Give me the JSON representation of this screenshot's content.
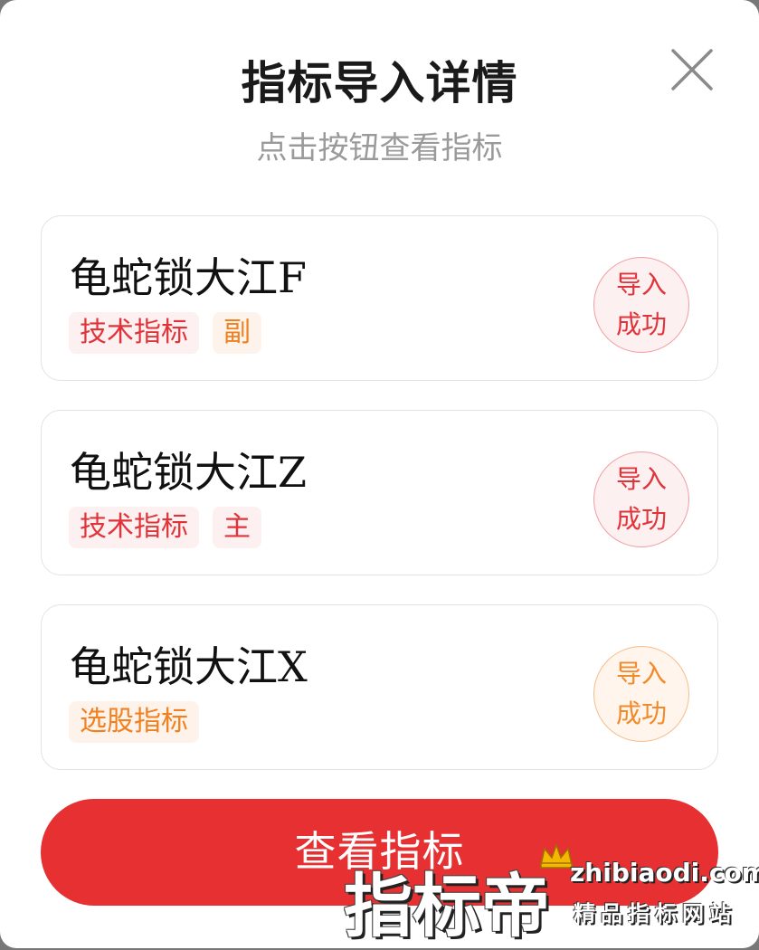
{
  "dialog": {
    "title": "指标导入详情",
    "subtitle": "点击按钮查看指标",
    "close_icon": "close-icon"
  },
  "items": [
    {
      "name": "龟蛇锁大江F",
      "tags": [
        {
          "label": "技术指标",
          "color": "red"
        },
        {
          "label": "副",
          "color": "orange"
        }
      ],
      "status_line1": "导入",
      "status_line2": "成功",
      "status_color": "red"
    },
    {
      "name": "龟蛇锁大江Z",
      "tags": [
        {
          "label": "技术指标",
          "color": "red"
        },
        {
          "label": "主",
          "color": "red"
        }
      ],
      "status_line1": "导入",
      "status_line2": "成功",
      "status_color": "red"
    },
    {
      "name": "龟蛇锁大江X",
      "tags": [
        {
          "label": "选股指标",
          "color": "orange"
        }
      ],
      "status_line1": "导入",
      "status_line2": "成功",
      "status_color": "orange"
    }
  ],
  "action_button": {
    "label": "查看指标"
  },
  "watermark": {
    "brand": "指标帝",
    "site": "zhibiaodi.com",
    "slogan": "精品指标网站"
  },
  "colors": {
    "accent": "#e63031",
    "tag_red": "#e0343a",
    "tag_orange": "#f08020"
  }
}
